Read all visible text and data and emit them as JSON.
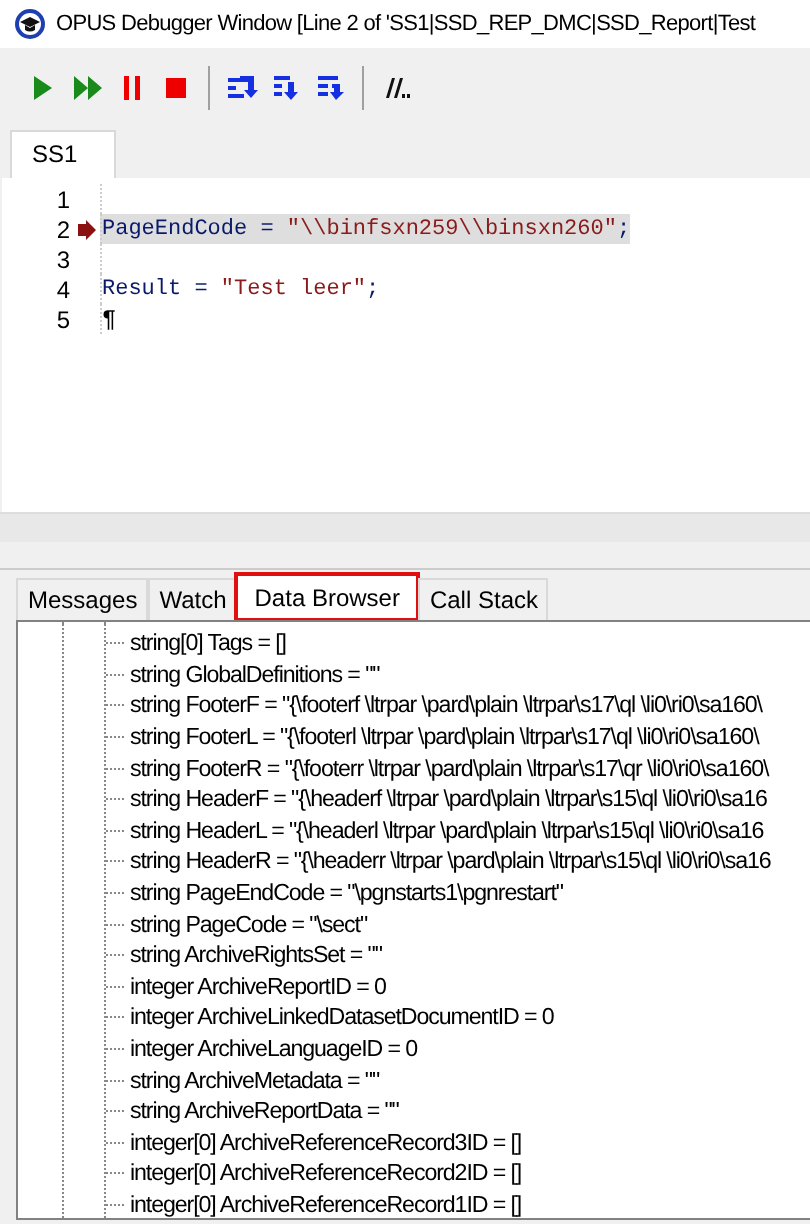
{
  "window": {
    "title": "OPUS Debugger Window [Line 2 of 'SS1|SSD_REP_DMC|SSD_Report|Test"
  },
  "toolbar": [
    {
      "kind": "run"
    },
    {
      "kind": "run-to-end"
    },
    {
      "kind": "pause"
    },
    {
      "kind": "stop"
    },
    {
      "kind": "separator"
    },
    {
      "kind": "step-over"
    },
    {
      "kind": "step-into"
    },
    {
      "kind": "step-out"
    },
    {
      "kind": "separator"
    },
    {
      "kind": "comment"
    }
  ],
  "editor_tabs": [
    {
      "label": "SS1",
      "selected": true
    }
  ],
  "code_lines": [
    {
      "number": "1",
      "current": false,
      "breakpoint": false
    },
    {
      "number": "2",
      "current": true,
      "breakpoint": true,
      "tokens": [
        {
          "kind": "plain",
          "text": "PageEndCode = "
        },
        {
          "kind": "string",
          "text": "\"\\\\binfsxn259\\\\binsxn260\""
        },
        {
          "kind": "plain",
          "text": ";"
        }
      ]
    },
    {
      "number": "3",
      "current": false,
      "breakpoint": false
    },
    {
      "number": "4",
      "current": false,
      "breakpoint": false,
      "tokens": [
        {
          "kind": "plain",
          "text": "Result = "
        },
        {
          "kind": "string",
          "text": "\"Test leer\""
        },
        {
          "kind": "plain",
          "text": ";"
        }
      ]
    },
    {
      "number": "5",
      "current": false,
      "breakpoint": false,
      "tokens": [
        {
          "kind": "marker",
          "text": "¶"
        }
      ]
    }
  ],
  "panel_tabs": [
    {
      "label": "Messages",
      "selected": false
    },
    {
      "label": "Watch",
      "selected": false
    },
    {
      "label": "Data Browser",
      "selected": true
    },
    {
      "label": "Call Stack",
      "selected": false
    }
  ],
  "data_browser": {
    "rows": [
      "string[0] Tags = []",
      "string GlobalDefinitions = \"\"",
      "string FooterF = \"{\\footerf \\ltrpar \\pard\\plain \\ltrpar\\s17\\ql \\li0\\ri0\\sa160\\",
      "string FooterL = \"{\\footerl \\ltrpar \\pard\\plain \\ltrpar\\s17\\ql \\li0\\ri0\\sa160\\",
      "string FooterR = \"{\\footerr \\ltrpar \\pard\\plain \\ltrpar\\s17\\qr \\li0\\ri0\\sa160\\",
      "string HeaderF = \"{\\headerf \\ltrpar \\pard\\plain \\ltrpar\\s15\\ql \\li0\\ri0\\sa16",
      "string HeaderL = \"{\\headerl \\ltrpar \\pard\\plain \\ltrpar\\s15\\ql \\li0\\ri0\\sa16",
      "string HeaderR = \"{\\headerr \\ltrpar \\pard\\plain \\ltrpar\\s15\\ql \\li0\\ri0\\sa16",
      "string PageEndCode = \"\\pgnstarts1\\pgnrestart\"",
      "string PageCode = \"\\sect\"",
      "string ArchiveRightsSet = \"\"",
      "integer ArchiveReportID = 0",
      "integer ArchiveLinkedDatasetDocumentID = 0",
      "integer ArchiveLanguageID = 0",
      "string ArchiveMetadata = \"\"",
      "string ArchiveReportData = \"\"",
      "integer[0] ArchiveReferenceRecord3ID = []",
      "integer[0] ArchiveReferenceRecord2ID = []",
      "integer[0] ArchiveReferenceRecord1ID = []"
    ]
  }
}
